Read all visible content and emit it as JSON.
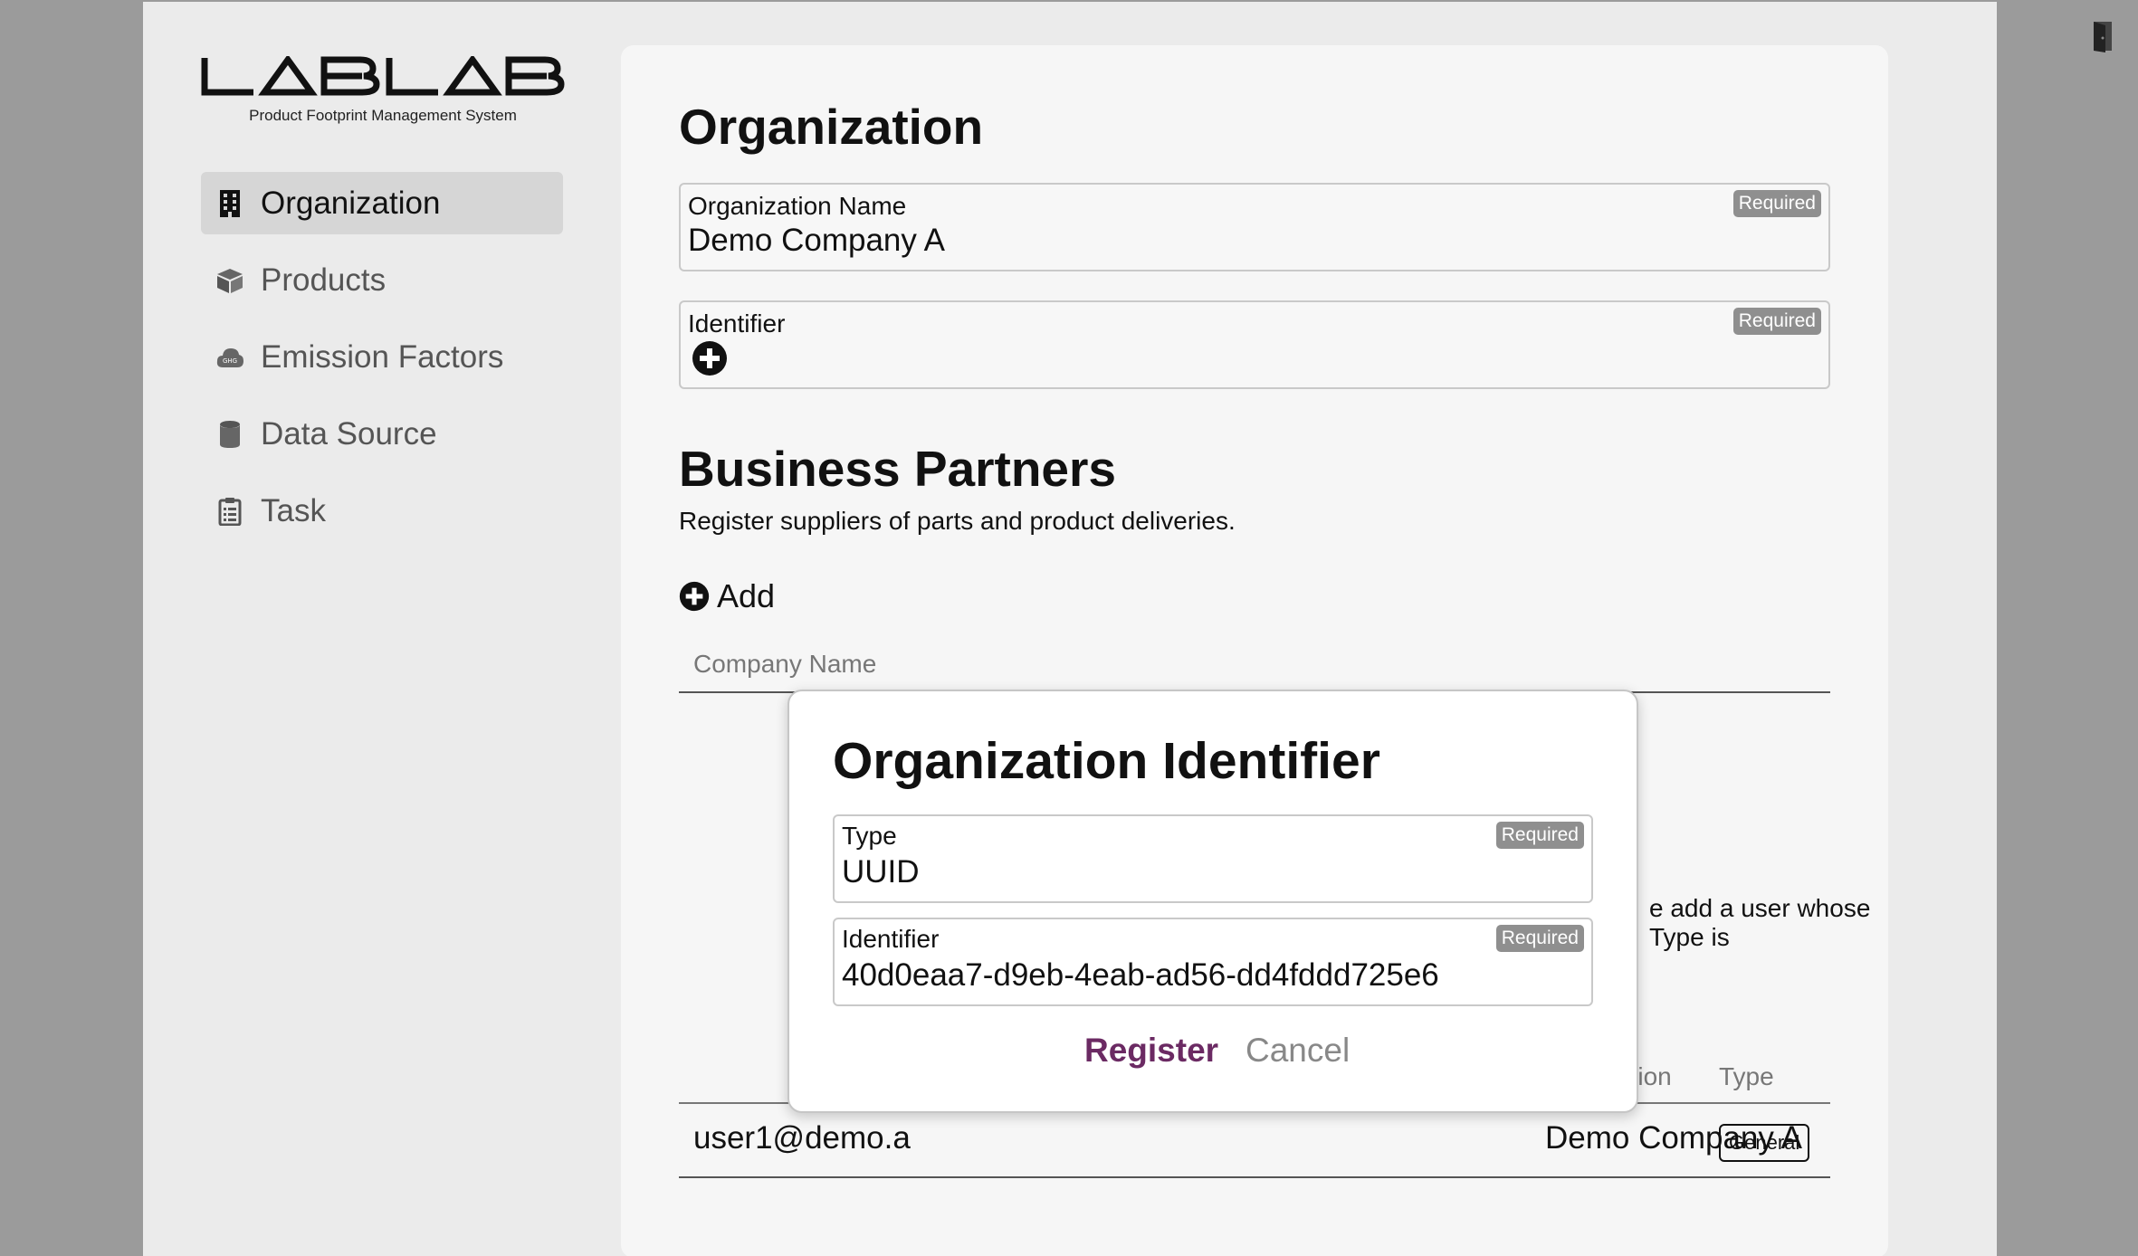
{
  "brand": {
    "logo_text": "LABLAB",
    "subtitle": "Product Footprint Management System"
  },
  "sidebar": {
    "items": [
      {
        "label": "Organization",
        "icon": "building-icon",
        "active": true
      },
      {
        "label": "Products",
        "icon": "box-icon",
        "active": false
      },
      {
        "label": "Emission Factors",
        "icon": "ghg-cloud-icon",
        "active": false
      },
      {
        "label": "Data Source",
        "icon": "database-icon",
        "active": false
      },
      {
        "label": "Task",
        "icon": "clipboard-list-icon",
        "active": false
      }
    ]
  },
  "organization": {
    "heading": "Organization",
    "name_label": "Organization Name",
    "name_value": "Demo Company A",
    "identifier_label": "Identifier",
    "required_label": "Required"
  },
  "partners": {
    "heading": "Business Partners",
    "description": "Register suppliers of parts and product deliveries.",
    "add_label": "Add",
    "company_name_header": "Company Name"
  },
  "users": {
    "partial_text": "e add a user whose Type is",
    "header_org_partial": "ation",
    "header_type": "Type",
    "rows": [
      {
        "email": "user1@demo.a",
        "organization": "Demo Company A",
        "type": "General"
      }
    ]
  },
  "modal": {
    "title": "Organization Identifier",
    "type_label": "Type",
    "type_value": "UUID",
    "identifier_label": "Identifier",
    "identifier_value": "40d0eaa7-d9eb-4eab-ad56-dd4fddd725e6",
    "required_label": "Required",
    "register_label": "Register",
    "cancel_label": "Cancel"
  },
  "colors": {
    "accent": "#6b2a63",
    "badge_bg": "#8f8f8f",
    "sidebar_active": "#d6d6d6"
  }
}
